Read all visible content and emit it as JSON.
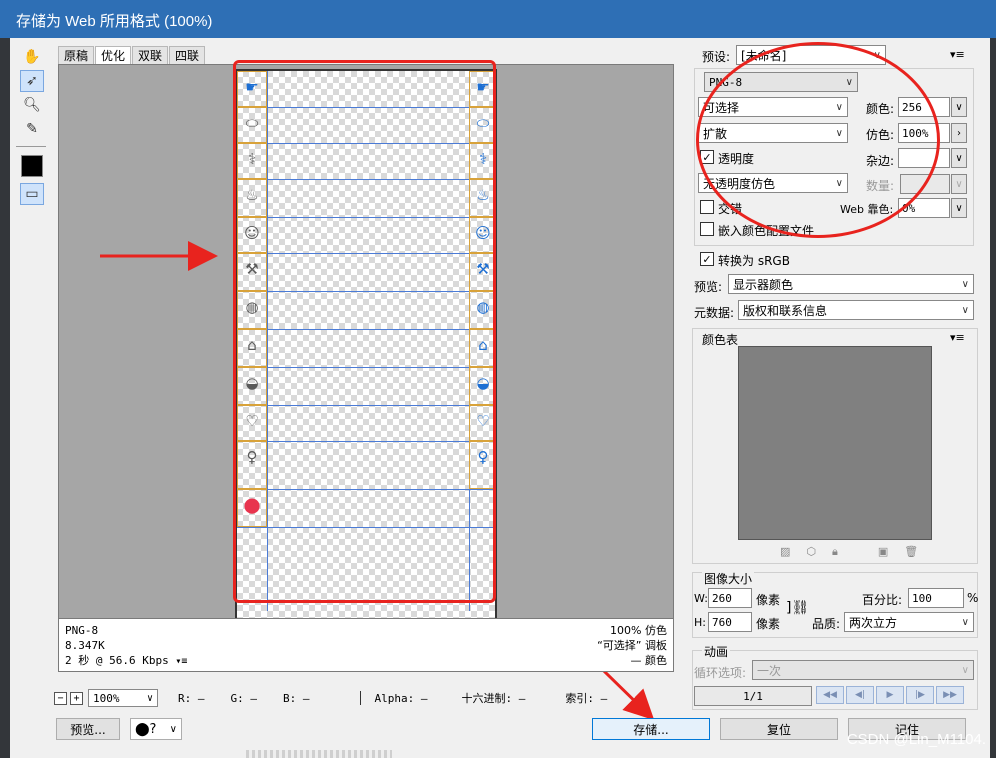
{
  "window": {
    "title": "存储为 Web 所用格式 (100%)"
  },
  "tabs": [
    "原稿",
    "优化",
    "双联",
    "四联"
  ],
  "tools": [
    "hand-icon",
    "slice-select-icon",
    "zoom-icon",
    "eyedropper-icon",
    "color-swatch",
    "slice-visibility-icon"
  ],
  "info": {
    "format": "PNG-8",
    "size": "8.347K",
    "speed": "2 秒 @ 56.6 Kbps",
    "dither_pct": "100% 仿色",
    "palette": "“可选择” 调板",
    "colors": "— 颜色"
  },
  "statusbar": {
    "zoom": "100%",
    "r": "R: —",
    "g": "G: —",
    "b": "B: —",
    "alpha": "Alpha: —",
    "hex": "十六进制: —",
    "index": "索引: —"
  },
  "buttons": {
    "preview": "预览...",
    "save": "存储...",
    "reset": "复位",
    "remember": "记住"
  },
  "settings": {
    "preset_label": "预设:",
    "preset_value": "[未命名]",
    "format": "PNG-8",
    "reduction": "可选择",
    "dither_algo": "扩散",
    "transparency_label": "透明度",
    "matte_dither": "无透明度仿色",
    "interlaced_label": "交错",
    "embed_profile_label": "嵌入颜色配置文件",
    "colors_label": "颜色:",
    "colors_value": "256",
    "dither_label": "仿色:",
    "dither_value": "100%",
    "matte_label": "杂边:",
    "amount_label": "数量:",
    "web_snap_label": "Web 靠色:",
    "web_snap_value": "0%",
    "convert_srgb": "转换为 sRGB",
    "preview_label": "预览:",
    "preview_value": "显示器颜色",
    "metadata_label": "元数据:",
    "metadata_value": "版权和联系信息"
  },
  "color_table": {
    "title": "颜色表"
  },
  "image_size": {
    "title": "图像大小",
    "w_label": "W:",
    "w_value": "260",
    "h_label": "H:",
    "h_value": "760",
    "unit": "像素",
    "percent_label": "百分比:",
    "percent_value": "100",
    "percent_unit": "%",
    "quality_label": "品质:",
    "quality_value": "两次立方"
  },
  "animation": {
    "title": "动画",
    "loop_label": "循环选项:",
    "loop_value": "一次",
    "frame": "1/1"
  },
  "sprite_icons_left": [
    "hand-drop",
    "pill",
    "stethoscope",
    "cake",
    "baby",
    "tools",
    "globe",
    "house",
    "bowl",
    "heart-hands",
    "person",
    "pin"
  ],
  "watermark": "CSDN @Lin_M1104.",
  "colors": {
    "annotation_red": "#e8231e",
    "title_blue": "#2e6fb5",
    "icon_blue": "#1d6fd3",
    "pin_red": "#e8344e"
  }
}
